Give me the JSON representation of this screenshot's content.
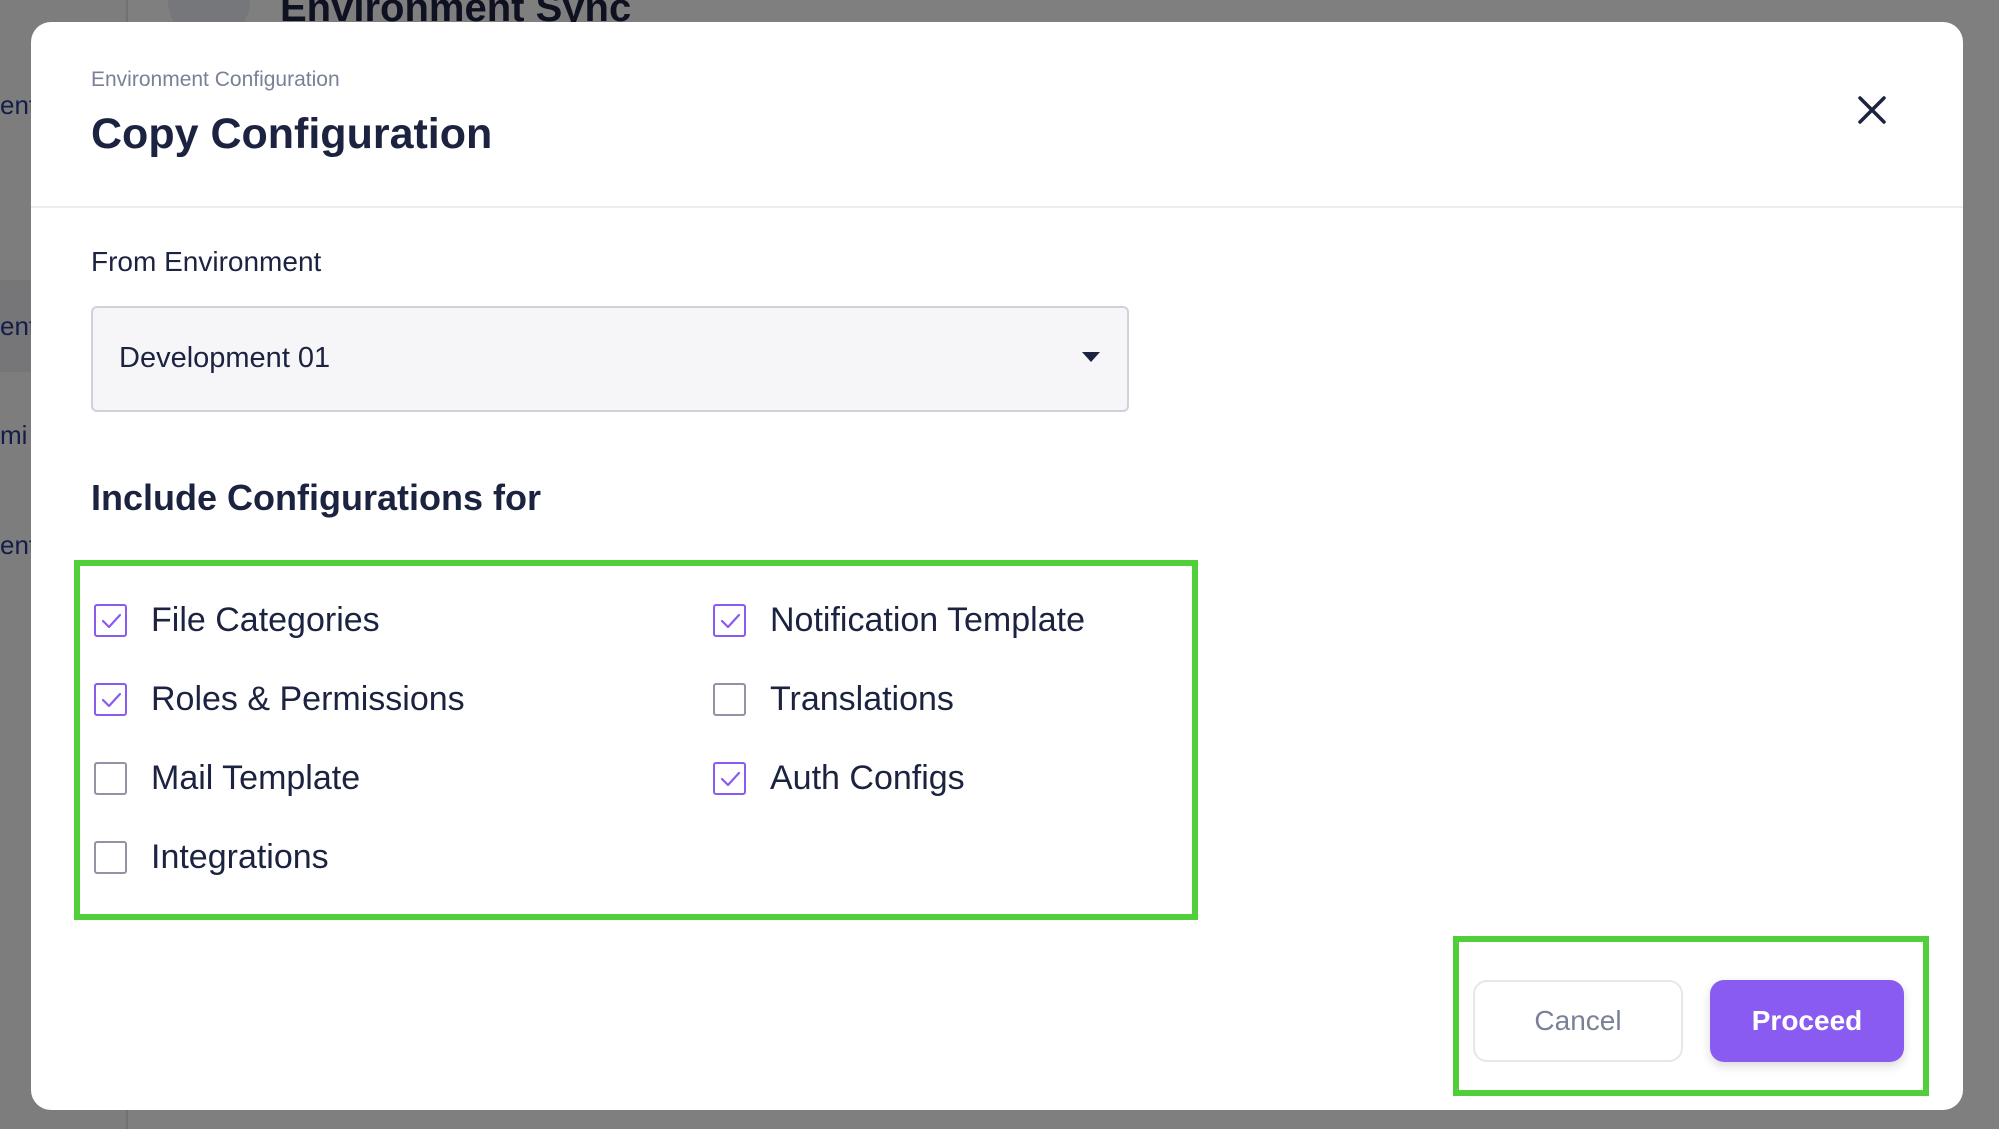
{
  "background": {
    "page_title": "Environment Sync",
    "sidebar_items": [
      {
        "label": "ent"
      },
      {
        "label": "ent"
      },
      {
        "label": "mi"
      },
      {
        "label": "ent"
      }
    ]
  },
  "modal": {
    "eyebrow": "Environment Configuration",
    "title": "Copy Configuration",
    "close_icon": "close-icon"
  },
  "from_environment": {
    "label": "From Environment",
    "selected": "Development 01"
  },
  "include": {
    "title": "Include Configurations for",
    "options": [
      {
        "label": "File Categories",
        "checked": true
      },
      {
        "label": "Notification Template",
        "checked": true
      },
      {
        "label": "Roles & Permissions",
        "checked": true
      },
      {
        "label": "Translations",
        "checked": false
      },
      {
        "label": "Mail Template",
        "checked": false
      },
      {
        "label": "Auth Configs",
        "checked": true
      },
      {
        "label": "Integrations",
        "checked": false
      }
    ]
  },
  "actions": {
    "cancel_label": "Cancel",
    "proceed_label": "Proceed"
  },
  "colors": {
    "accent": "#8a5bf0",
    "highlight": "#50cf3a",
    "text": "#1c2340"
  }
}
